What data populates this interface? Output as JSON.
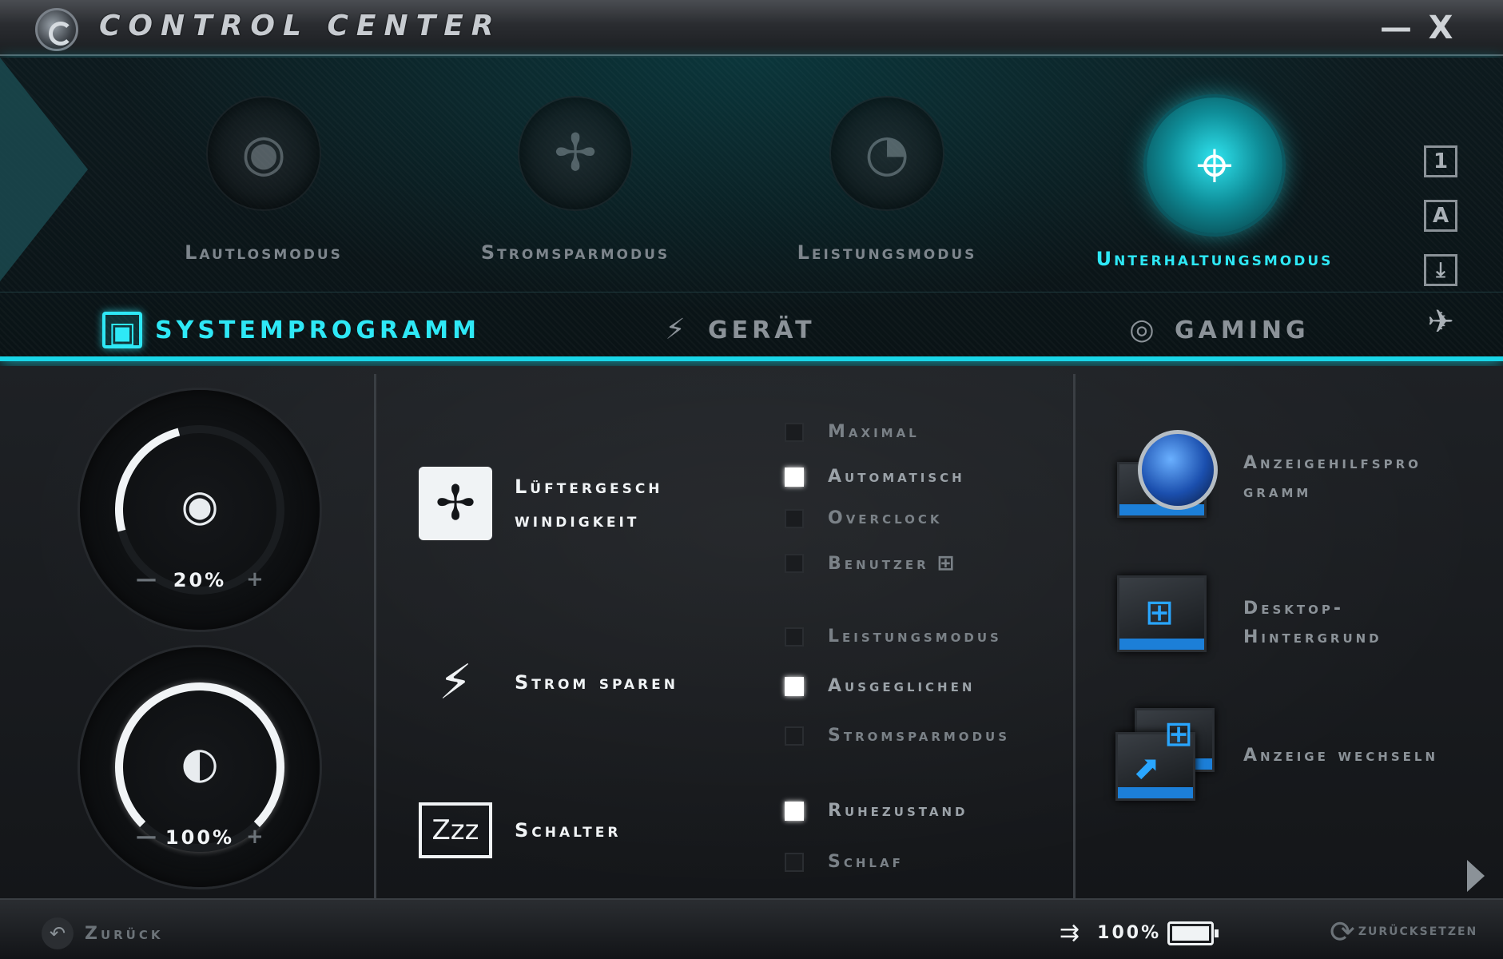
{
  "window": {
    "title": "CONTROL CENTER",
    "minimize_glyph": "—",
    "close_glyph": "X"
  },
  "modes": [
    {
      "label": "Lautlosmodus",
      "icon": "speaker-icon",
      "active": false
    },
    {
      "label": "Stromsparmodus",
      "icon": "fan-blade-icon",
      "active": false
    },
    {
      "label": "Leistungsmodus",
      "icon": "speedometer-icon",
      "active": false
    },
    {
      "label": "Unterhaltungsmodus",
      "icon": "crosshair-icon",
      "active": true
    }
  ],
  "side_icons": [
    {
      "glyph": "1",
      "icon": "profile-1-icon"
    },
    {
      "glyph": "A",
      "icon": "caps-lock-icon"
    },
    {
      "glyph": "⤓",
      "icon": "scroll-lock-icon"
    },
    {
      "glyph": "✈",
      "icon": "airplane-icon"
    }
  ],
  "tabs": [
    {
      "label": "SYSTEMPROGRAMM",
      "icon": "monitor-icon",
      "glyph": "▣",
      "active": true
    },
    {
      "label": "GERÄT",
      "icon": "plug-icon",
      "glyph": "⚡",
      "active": false
    },
    {
      "label": "GAMING",
      "icon": "steering-wheel-icon",
      "glyph": "◎",
      "active": false
    }
  ],
  "gauges": [
    {
      "name": "volume",
      "icon": "speaker-target-icon",
      "glyph": "◉",
      "value": "20%",
      "minus": "—",
      "plus": "+",
      "level": 0.2
    },
    {
      "name": "brightness",
      "icon": "brightness-icon",
      "glyph": "◐",
      "value": "100%",
      "minus": "—",
      "plus": "+",
      "level": 1.0
    }
  ],
  "features": [
    {
      "label": "Lüftergesch windigkeit",
      "icon": "fan-icon",
      "glyph": "✢"
    },
    {
      "label": "Strom sparen",
      "icon": "power-plug-icon",
      "glyph": "⚡"
    },
    {
      "label": "Schalter",
      "icon": "sleep-laptop-icon",
      "glyph": "Zzz"
    }
  ],
  "fan_options": [
    {
      "label": "Maximal",
      "checked": false
    },
    {
      "label": "Automatisch",
      "checked": true
    },
    {
      "label": "Overclock",
      "checked": false
    },
    {
      "label": "Benutzer",
      "checked": false
    }
  ],
  "power_options": [
    {
      "label": "Leistungsmodus",
      "checked": false
    },
    {
      "label": "Ausgeglichen",
      "checked": true
    },
    {
      "label": "Stromsparmodus",
      "checked": false
    }
  ],
  "switch_options": [
    {
      "label": "Ruhezustand",
      "checked": true
    },
    {
      "label": "Schlaf",
      "checked": false
    }
  ],
  "tools": [
    {
      "label": "Anzeigehilfspro gramm",
      "icon": "display-helper-icon"
    },
    {
      "label": "Desktop- Hintergrund",
      "icon": "wallpaper-icon"
    },
    {
      "label": "Anzeige wechseln",
      "icon": "switch-display-icon"
    }
  ],
  "status": {
    "back_label": "Zurück",
    "battery_pct": "100%",
    "battery_level": 1.0,
    "reset_label": "ZURÜCKSETZEN"
  },
  "colors": {
    "accent": "#2ee8f6",
    "checked": "#ffffff",
    "muted": "#7a8187"
  }
}
